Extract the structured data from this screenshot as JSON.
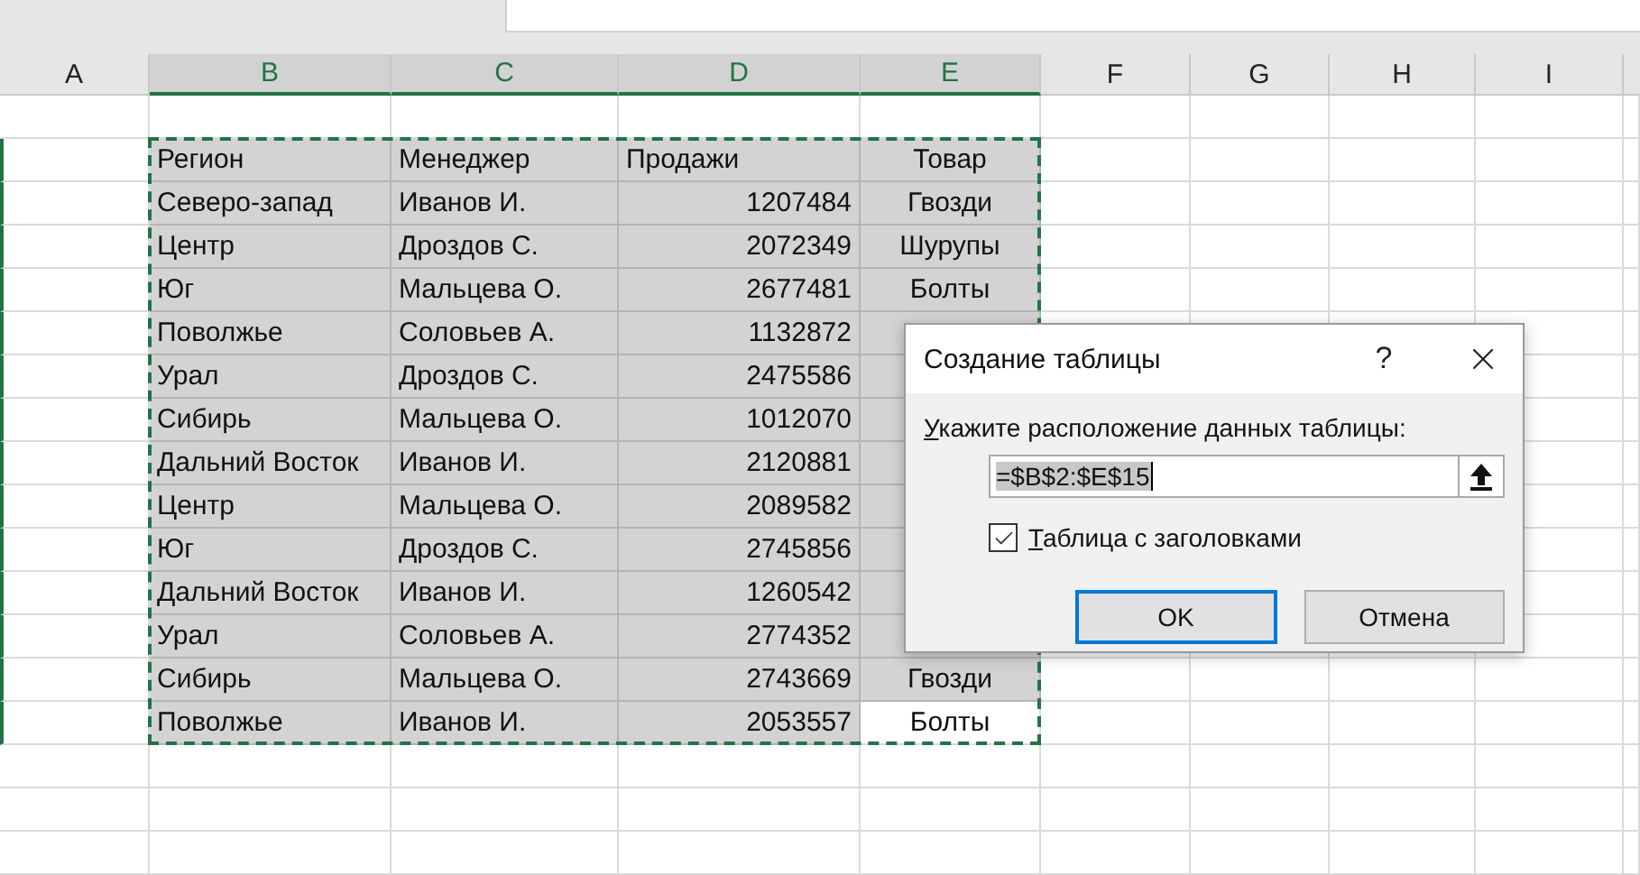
{
  "columns": [
    {
      "label": "A",
      "selected": false
    },
    {
      "label": "B",
      "selected": true
    },
    {
      "label": "C",
      "selected": true
    },
    {
      "label": "D",
      "selected": true
    },
    {
      "label": "E",
      "selected": true
    },
    {
      "label": "F",
      "selected": false
    },
    {
      "label": "G",
      "selected": false
    },
    {
      "label": "H",
      "selected": false
    },
    {
      "label": "I",
      "selected": false
    }
  ],
  "table": {
    "rows": [
      {
        "cells": [
          "Регион",
          "Менеджер",
          "Продажи",
          "Товар"
        ],
        "active": false
      },
      {
        "cells": [
          "Северо-запад",
          "Иванов И.",
          "1207484",
          "Гвозди"
        ],
        "active": false
      },
      {
        "cells": [
          "Центр",
          "Дроздов С.",
          "2072349",
          "Шурупы"
        ],
        "active": false
      },
      {
        "cells": [
          "Юг",
          "Мальцева О.",
          "2677481",
          "Болты"
        ],
        "active": false
      },
      {
        "cells": [
          "Поволжье",
          "Соловьев А.",
          "1132872"
        ],
        "active": false
      },
      {
        "cells": [
          "Урал",
          "Дроздов С.",
          "2475586"
        ],
        "active": false
      },
      {
        "cells": [
          "Сибирь",
          "Мальцева О.",
          "1012070"
        ],
        "active": false
      },
      {
        "cells": [
          "Дальний Восток",
          "Иванов И.",
          "2120881"
        ],
        "active": false
      },
      {
        "cells": [
          "Центр",
          "Мальцева О.",
          "2089582"
        ],
        "active": false
      },
      {
        "cells": [
          "Юг",
          "Дроздов С.",
          "2745856"
        ],
        "active": false
      },
      {
        "cells": [
          "Дальний Восток",
          "Иванов И.",
          "1260542"
        ],
        "active": false
      },
      {
        "cells": [
          "Урал",
          "Соловьев А.",
          "2774352"
        ],
        "active": false
      },
      {
        "cells": [
          "Сибирь",
          "Мальцева О.",
          "2743669",
          "Гвозди"
        ],
        "active": false
      },
      {
        "cells": [
          "Поволжье",
          "Иванов И.",
          "2053557",
          "Болты"
        ],
        "active": true
      }
    ]
  },
  "dialog": {
    "title": "Создание таблицы",
    "help": "?",
    "label": "Укажите расположение данных таблицы:",
    "range": "=$B$2:$E$15",
    "headers": {
      "label": "Таблица с заголовками",
      "checked": true
    },
    "buttons": [
      {
        "label": "OK",
        "default": true
      },
      {
        "label": "Отмена",
        "default": false
      }
    ]
  }
}
